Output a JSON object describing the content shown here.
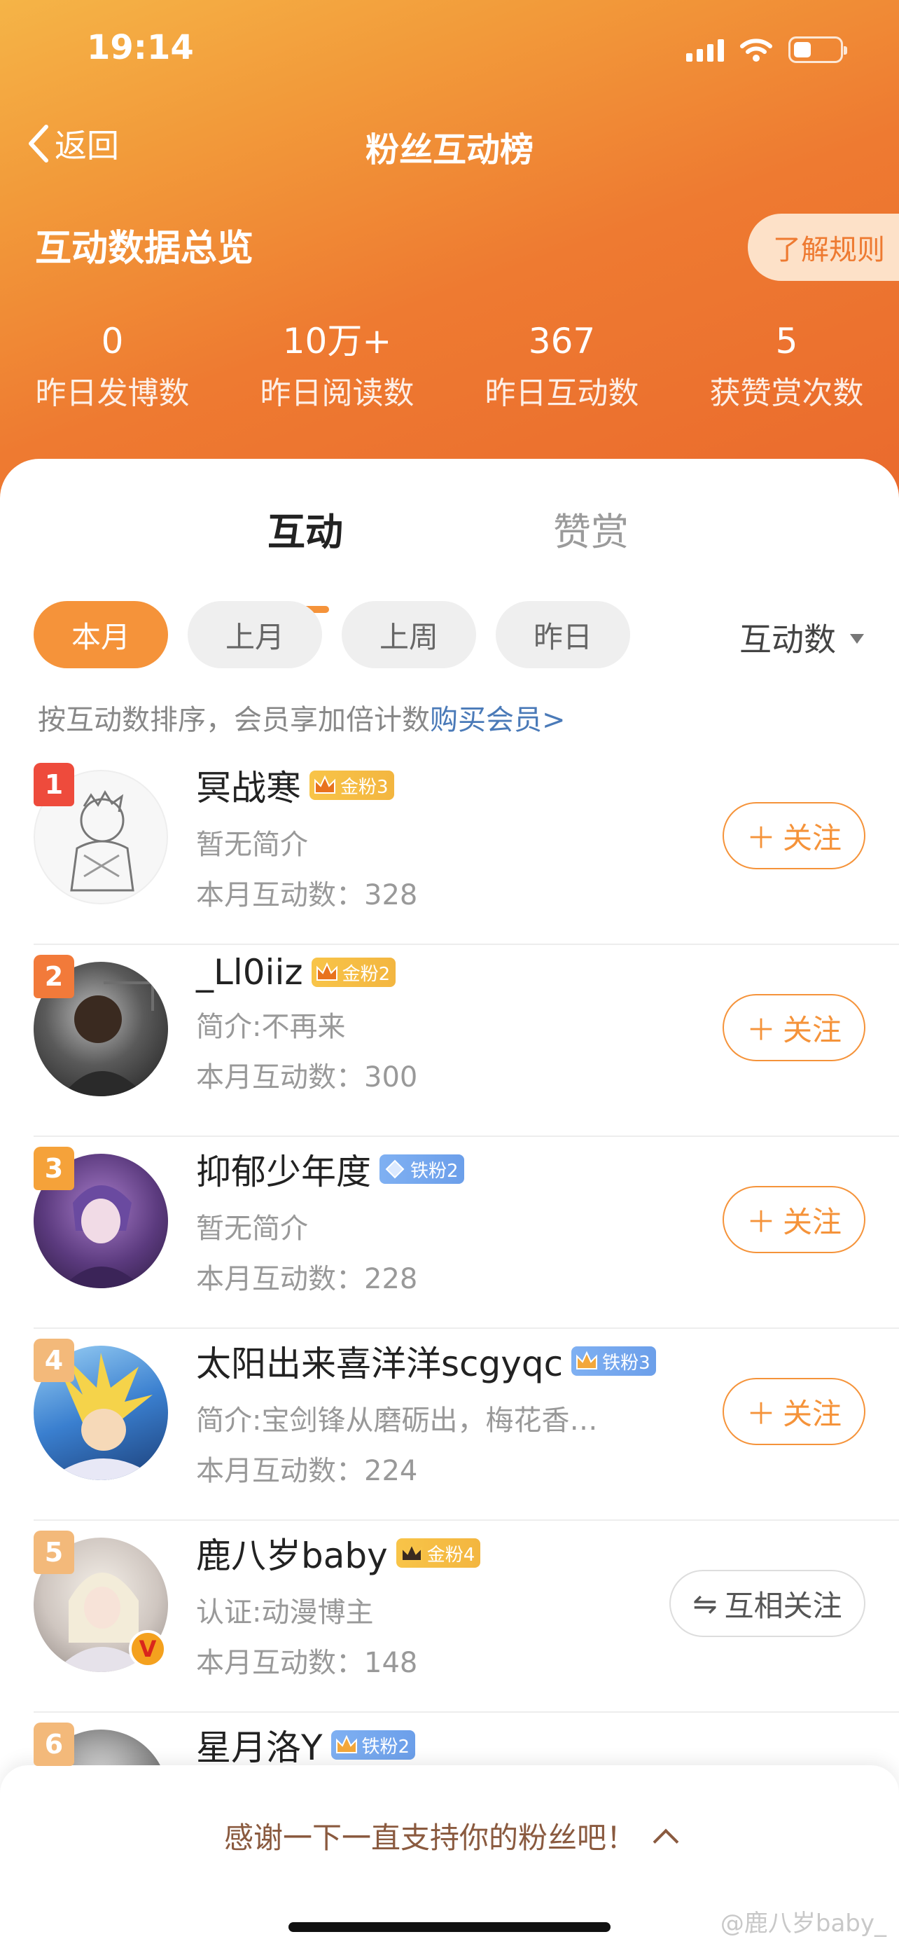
{
  "status_bar": {
    "time": "19:14"
  },
  "nav": {
    "back_label": "返回",
    "title": "粉丝互动榜"
  },
  "overview": {
    "title": "互动数据总览",
    "rules_button": "了解规则",
    "stats": [
      {
        "value": "0",
        "label": "昨日发博数"
      },
      {
        "value": "10万+",
        "label": "昨日阅读数"
      },
      {
        "value": "367",
        "label": "昨日互动数"
      },
      {
        "value": "5",
        "label": "获赞赏次数"
      }
    ]
  },
  "tabs": [
    {
      "label": "互动",
      "active": true
    },
    {
      "label": "赞赏",
      "active": false
    }
  ],
  "filters": [
    "本月",
    "上月",
    "上周",
    "昨日"
  ],
  "sort_label": "互动数",
  "hint": {
    "text": "按互动数排序，会员享加倍计数",
    "link": "购买会员>"
  },
  "fans": [
    {
      "rank": "1",
      "name": "冥战寒",
      "badge": "金粉3",
      "badge_type": "gold",
      "desc": "暂无简介",
      "count": "本月互动数：328",
      "action": "关注",
      "rank_color": "#ee4b3c"
    },
    {
      "rank": "2",
      "name": "_Ll0iiz",
      "badge": "金粉2",
      "badge_type": "gold",
      "desc": "简介:不再来",
      "count": "本月互动数：300",
      "action": "关注",
      "rank_color": "#f27a3a"
    },
    {
      "rank": "3",
      "name": "抑郁少年度",
      "badge": "铁粉2",
      "badge_type": "iron",
      "desc": "暂无简介",
      "count": "本月互动数：228",
      "action": "关注",
      "rank_color": "#f5a23a"
    },
    {
      "rank": "4",
      "name": "太阳出来喜洋洋scgyqc",
      "badge": "铁粉3",
      "badge_type": "iron",
      "desc": "简介:宝剑锋从磨砺出，梅花香…",
      "count": "本月互动数：224",
      "action": "关注",
      "rank_color": "#f3b97a"
    },
    {
      "rank": "5",
      "name": "鹿八岁baby",
      "badge": "金粉4",
      "badge_type": "gold",
      "desc": "认证:动漫博主",
      "count": "本月互动数：148",
      "action": "互相关注",
      "rank_color": "#f3b97a"
    },
    {
      "rank": "6",
      "name": "星月洛Y",
      "badge": "铁粉2",
      "badge_type": "iron",
      "desc": "",
      "count": "",
      "action": "",
      "rank_color": "#f3b97a"
    }
  ],
  "bottom_sheet": {
    "text": "感谢一下一直支持你的粉丝吧！"
  },
  "watermark": "@鹿八岁baby_"
}
